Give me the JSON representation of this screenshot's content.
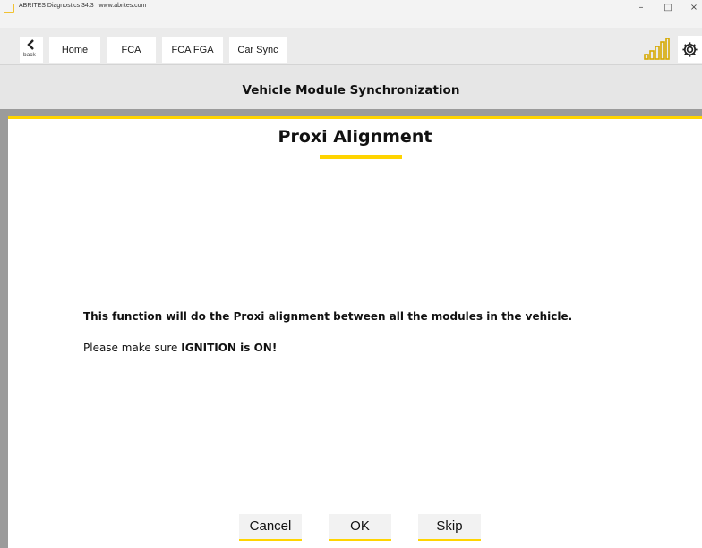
{
  "window": {
    "title": "ABRITES Diagnostics 34.3",
    "url": "www.abrites.com",
    "minimize": "–",
    "maximize": "□",
    "close": "×"
  },
  "nav": {
    "back_label": "back",
    "tabs": [
      {
        "label": "Home"
      },
      {
        "label": "FCA"
      },
      {
        "label": "FCA FGA"
      },
      {
        "label": "Car Sync"
      }
    ]
  },
  "header": {
    "title": "Vehicle Module Synchronization"
  },
  "main": {
    "title": "Proxi Alignment",
    "message": "This function will do the Proxi alignment between all the modules in the vehicle.",
    "instruction_prefix": "Please make sure ",
    "instruction_emphasis": "IGNITION is ON!"
  },
  "buttons": {
    "cancel": "Cancel",
    "ok": "OK",
    "skip": "Skip"
  },
  "icons": {
    "app": "abrites-app-icon",
    "back": "chevron-left-icon",
    "signal": "signal-strength-icon",
    "settings": "gear-icon"
  },
  "colors": {
    "accent": "#ffd400",
    "signal": "#d6a800"
  }
}
